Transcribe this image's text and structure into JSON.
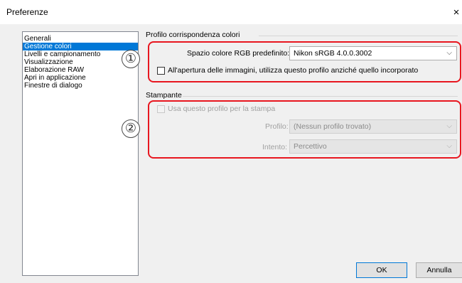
{
  "window": {
    "title": "Preferenze",
    "close_glyph": "×"
  },
  "sidebar": {
    "items": [
      {
        "label": "Generali",
        "selected": false
      },
      {
        "label": "Gestione colori",
        "selected": true
      },
      {
        "label": "Livelli e campionamento",
        "selected": false
      },
      {
        "label": "Visualizzazione",
        "selected": false
      },
      {
        "label": "Elaborazione RAW",
        "selected": false
      },
      {
        "label": "Apri in applicazione",
        "selected": false
      },
      {
        "label": "Finestre di dialogo",
        "selected": false
      }
    ]
  },
  "color_profile": {
    "group_title": "Profilo corrispondenza colori",
    "rgb_label": "Spazio colore RGB predefinito:",
    "rgb_value": "Nikon sRGB 4.0.0.3002",
    "embed_checkbox_label": "All'apertura delle immagini, utilizza questo profilo anziché quello incorporato",
    "embed_checked": false
  },
  "printer": {
    "group_title": "Stampante",
    "use_profile_label": "Usa questo profilo per la stampa",
    "use_profile_checked": false,
    "profile_label": "Profilo:",
    "profile_value": "(Nessun profilo trovato)",
    "intent_label": "Intento:",
    "intent_value": "Percettivo"
  },
  "annotations": {
    "marker_1": "①",
    "marker_2": "②",
    "highlight_color": "#e8161f"
  },
  "buttons": {
    "ok": "OK",
    "cancel": "Annulla"
  },
  "icons": {
    "chevron": "chevron-down-icon",
    "close": "close-icon"
  }
}
